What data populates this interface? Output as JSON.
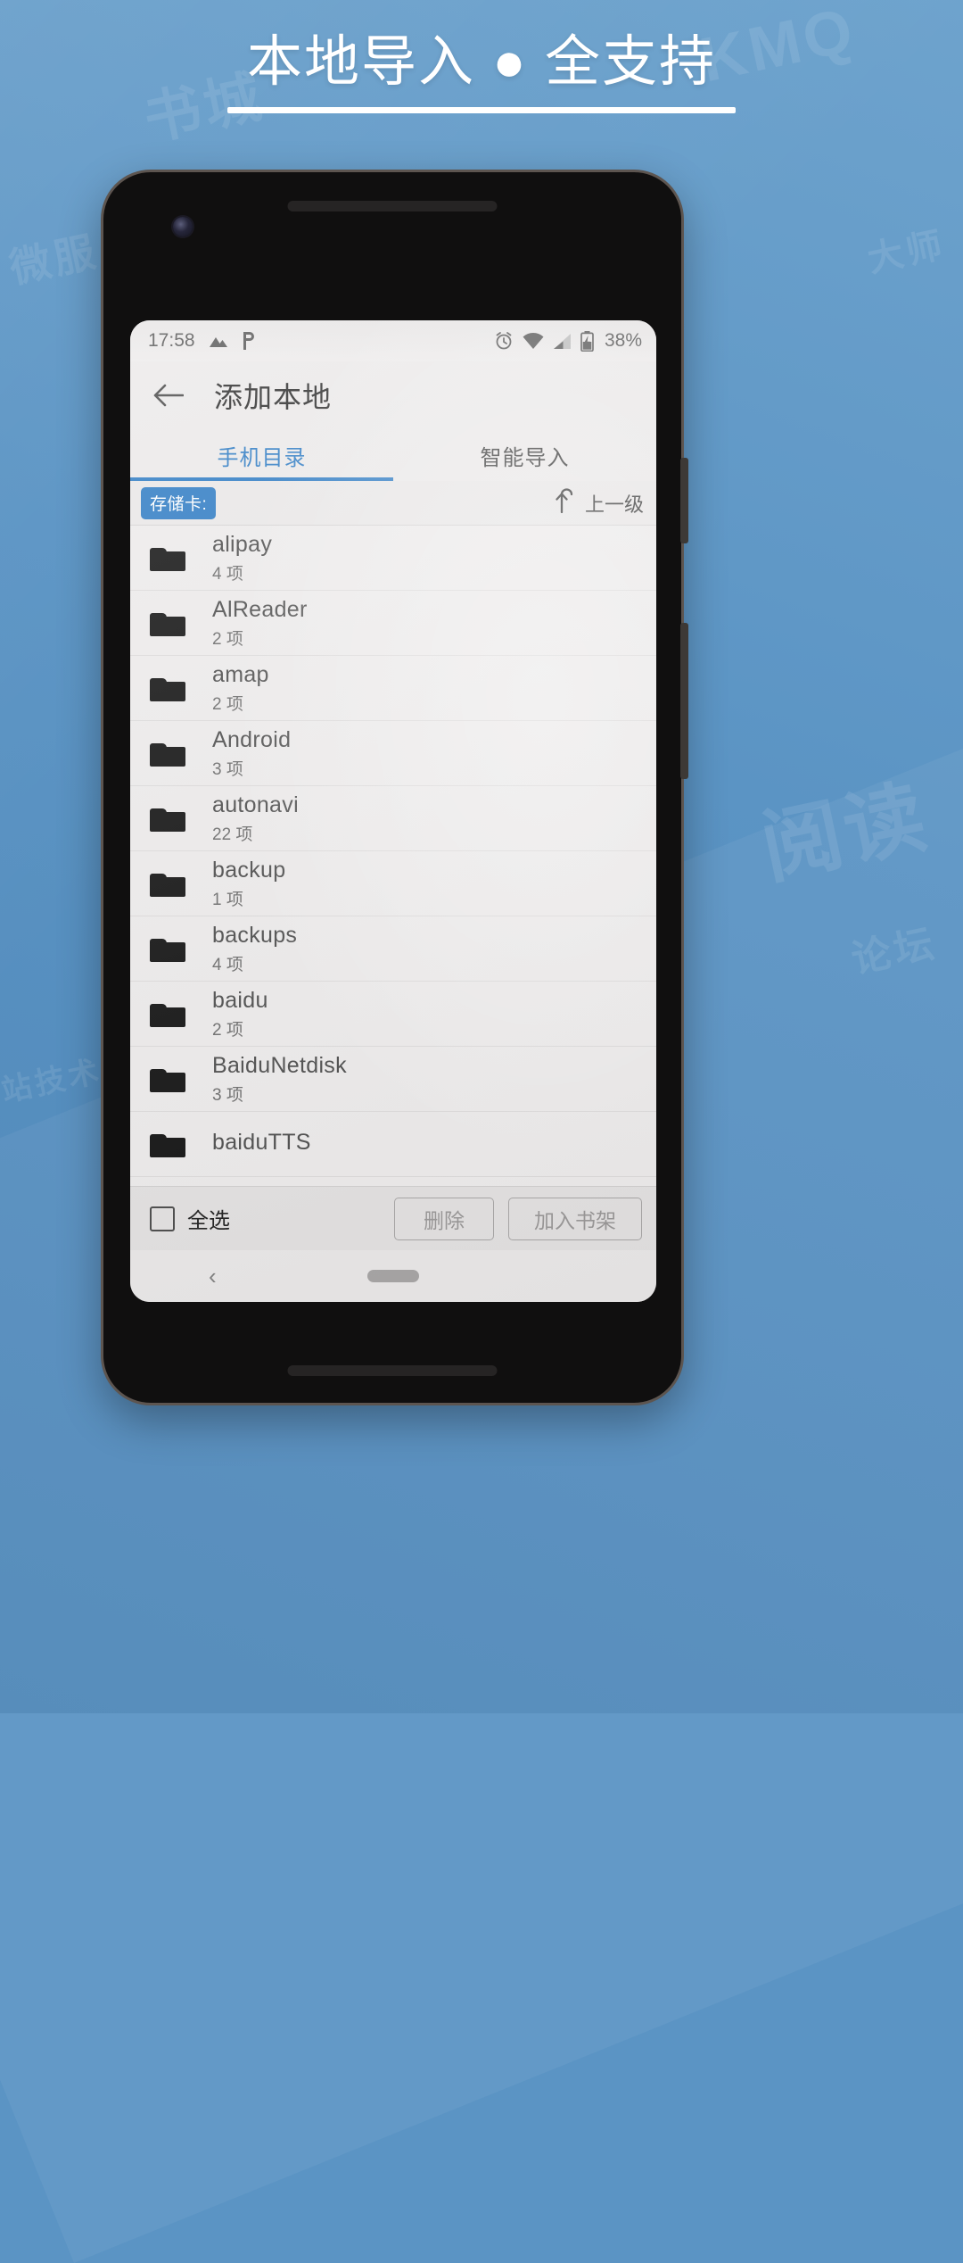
{
  "promo": {
    "title": "本地导入 ● 全支持",
    "watermarks": [
      "KMQ",
      "书城",
      "阅读",
      "论坛",
      "微服",
      "大师",
      "技术",
      "站技术器"
    ]
  },
  "status_bar": {
    "time": "17:58",
    "left_icons": [
      "image-icon",
      "parking-p-icon"
    ],
    "right_icons": [
      "alarm-icon",
      "wifi-icon",
      "signal-icon",
      "battery-charging-icon"
    ],
    "battery": "38%"
  },
  "app_bar": {
    "back_icon": "back-arrow-icon",
    "title": "添加本地"
  },
  "tabs": [
    {
      "label": "手机目录",
      "active": true
    },
    {
      "label": "智能导入",
      "active": false
    }
  ],
  "path_bar": {
    "crumb": "存储卡:",
    "up_icon": "up-level-arrow-icon",
    "up_label": "上一级"
  },
  "files": [
    {
      "name": "alipay",
      "count": "4 项"
    },
    {
      "name": "AlReader",
      "count": "2 项"
    },
    {
      "name": "amap",
      "count": "2 项"
    },
    {
      "name": "Android",
      "count": "3 项"
    },
    {
      "name": "autonavi",
      "count": "22 项"
    },
    {
      "name": "backup",
      "count": "1 项"
    },
    {
      "name": "backups",
      "count": "4 项"
    },
    {
      "name": "baidu",
      "count": "2 项"
    },
    {
      "name": "BaiduNetdisk",
      "count": "3 项"
    },
    {
      "name": "baiduTTS",
      "count": ""
    }
  ],
  "action_bar": {
    "select_all_label": "全选",
    "delete_label": "删除",
    "add_shelf_label": "加入书架"
  },
  "nav_bar": {
    "back_glyph": "‹",
    "home_pill": "home-pill"
  },
  "colors": {
    "promo_bg": "#5b94c4",
    "accent": "#2f7cc4",
    "screen_bg": "#eceaea",
    "text_primary": "#2e2e2e",
    "text_secondary": "#6d6d6d"
  }
}
